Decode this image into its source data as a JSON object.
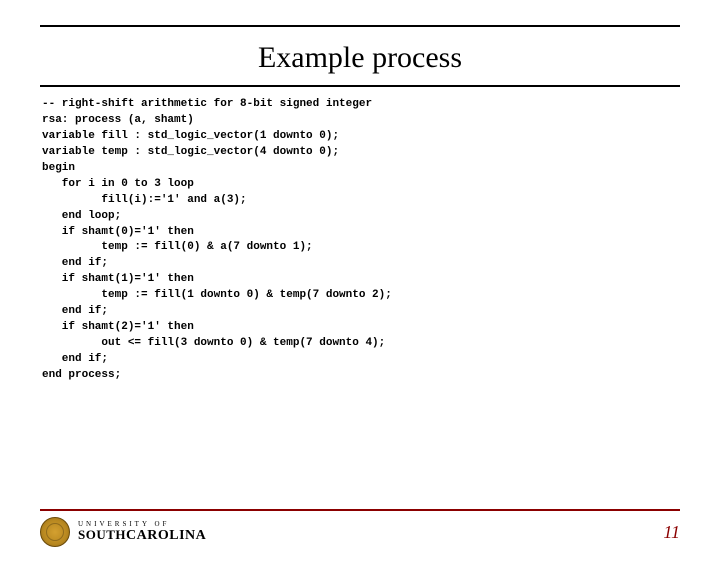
{
  "title": "Example process",
  "code": "-- right-shift arithmetic for 8-bit signed integer\nrsa: process (a, shamt)\nvariable fill : std_logic_vector(1 downto 0);\nvariable temp : std_logic_vector(4 downto 0);\nbegin\n   for i in 0 to 3 loop\n         fill(i):='1' and a(3);\n   end loop;\n   if shamt(0)='1' then\n         temp := fill(0) & a(7 downto 1);\n   end if;\n   if shamt(1)='1' then\n         temp := fill(1 downto 0) & temp(7 downto 2);\n   end if;\n   if shamt(2)='1' then\n         out <= fill(3 downto 0) & temp(7 downto 4);\n   end if;\nend process;",
  "logo": {
    "top": "UNIVERSITY OF",
    "south": "SOUTH",
    "carolina": "CAROLINA"
  },
  "page_number": "11"
}
